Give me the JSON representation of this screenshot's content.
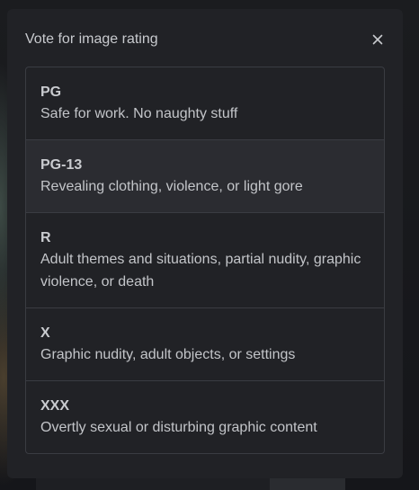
{
  "modal": {
    "title": "Vote for image rating",
    "close_icon": "close-icon"
  },
  "ratings": [
    {
      "name": "PG",
      "description": "Safe for work. No naughty stuff"
    },
    {
      "name": "PG-13",
      "description": "Revealing clothing, violence, or light gore"
    },
    {
      "name": "R",
      "description": "Adult themes and situations, partial nudity, graphic violence, or death"
    },
    {
      "name": "X",
      "description": "Graphic nudity, adult objects, or settings"
    },
    {
      "name": "XXX",
      "description": "Overtly sexual or disturbing graphic content"
    }
  ],
  "colors": {
    "modal_background": "#212226",
    "border": "#3a3c42",
    "hover_background": "#2b2c31",
    "text": "#c9cbcf"
  }
}
